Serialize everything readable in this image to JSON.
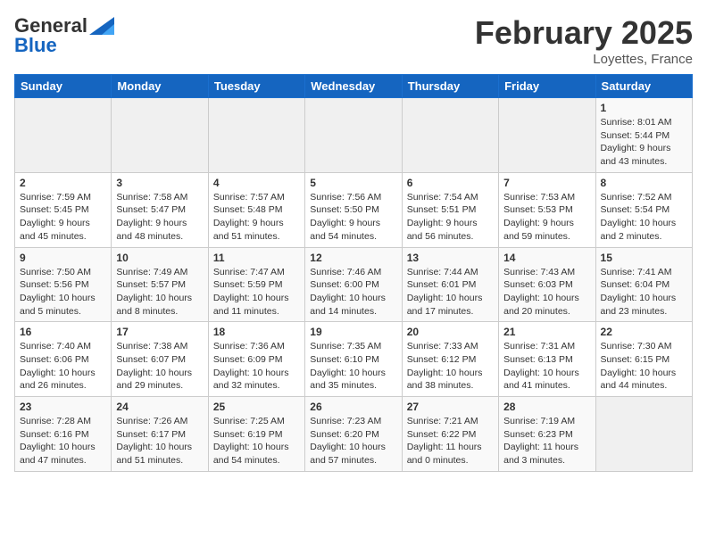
{
  "header": {
    "logo_general": "General",
    "logo_blue": "Blue",
    "month_title": "February 2025",
    "location": "Loyettes, France"
  },
  "calendar": {
    "days_of_week": [
      "Sunday",
      "Monday",
      "Tuesday",
      "Wednesday",
      "Thursday",
      "Friday",
      "Saturday"
    ],
    "weeks": [
      [
        {
          "day": "",
          "info": ""
        },
        {
          "day": "",
          "info": ""
        },
        {
          "day": "",
          "info": ""
        },
        {
          "day": "",
          "info": ""
        },
        {
          "day": "",
          "info": ""
        },
        {
          "day": "",
          "info": ""
        },
        {
          "day": "1",
          "info": "Sunrise: 8:01 AM\nSunset: 5:44 PM\nDaylight: 9 hours and 43 minutes."
        }
      ],
      [
        {
          "day": "2",
          "info": "Sunrise: 7:59 AM\nSunset: 5:45 PM\nDaylight: 9 hours and 45 minutes."
        },
        {
          "day": "3",
          "info": "Sunrise: 7:58 AM\nSunset: 5:47 PM\nDaylight: 9 hours and 48 minutes."
        },
        {
          "day": "4",
          "info": "Sunrise: 7:57 AM\nSunset: 5:48 PM\nDaylight: 9 hours and 51 minutes."
        },
        {
          "day": "5",
          "info": "Sunrise: 7:56 AM\nSunset: 5:50 PM\nDaylight: 9 hours and 54 minutes."
        },
        {
          "day": "6",
          "info": "Sunrise: 7:54 AM\nSunset: 5:51 PM\nDaylight: 9 hours and 56 minutes."
        },
        {
          "day": "7",
          "info": "Sunrise: 7:53 AM\nSunset: 5:53 PM\nDaylight: 9 hours and 59 minutes."
        },
        {
          "day": "8",
          "info": "Sunrise: 7:52 AM\nSunset: 5:54 PM\nDaylight: 10 hours and 2 minutes."
        }
      ],
      [
        {
          "day": "9",
          "info": "Sunrise: 7:50 AM\nSunset: 5:56 PM\nDaylight: 10 hours and 5 minutes."
        },
        {
          "day": "10",
          "info": "Sunrise: 7:49 AM\nSunset: 5:57 PM\nDaylight: 10 hours and 8 minutes."
        },
        {
          "day": "11",
          "info": "Sunrise: 7:47 AM\nSunset: 5:59 PM\nDaylight: 10 hours and 11 minutes."
        },
        {
          "day": "12",
          "info": "Sunrise: 7:46 AM\nSunset: 6:00 PM\nDaylight: 10 hours and 14 minutes."
        },
        {
          "day": "13",
          "info": "Sunrise: 7:44 AM\nSunset: 6:01 PM\nDaylight: 10 hours and 17 minutes."
        },
        {
          "day": "14",
          "info": "Sunrise: 7:43 AM\nSunset: 6:03 PM\nDaylight: 10 hours and 20 minutes."
        },
        {
          "day": "15",
          "info": "Sunrise: 7:41 AM\nSunset: 6:04 PM\nDaylight: 10 hours and 23 minutes."
        }
      ],
      [
        {
          "day": "16",
          "info": "Sunrise: 7:40 AM\nSunset: 6:06 PM\nDaylight: 10 hours and 26 minutes."
        },
        {
          "day": "17",
          "info": "Sunrise: 7:38 AM\nSunset: 6:07 PM\nDaylight: 10 hours and 29 minutes."
        },
        {
          "day": "18",
          "info": "Sunrise: 7:36 AM\nSunset: 6:09 PM\nDaylight: 10 hours and 32 minutes."
        },
        {
          "day": "19",
          "info": "Sunrise: 7:35 AM\nSunset: 6:10 PM\nDaylight: 10 hours and 35 minutes."
        },
        {
          "day": "20",
          "info": "Sunrise: 7:33 AM\nSunset: 6:12 PM\nDaylight: 10 hours and 38 minutes."
        },
        {
          "day": "21",
          "info": "Sunrise: 7:31 AM\nSunset: 6:13 PM\nDaylight: 10 hours and 41 minutes."
        },
        {
          "day": "22",
          "info": "Sunrise: 7:30 AM\nSunset: 6:15 PM\nDaylight: 10 hours and 44 minutes."
        }
      ],
      [
        {
          "day": "23",
          "info": "Sunrise: 7:28 AM\nSunset: 6:16 PM\nDaylight: 10 hours and 47 minutes."
        },
        {
          "day": "24",
          "info": "Sunrise: 7:26 AM\nSunset: 6:17 PM\nDaylight: 10 hours and 51 minutes."
        },
        {
          "day": "25",
          "info": "Sunrise: 7:25 AM\nSunset: 6:19 PM\nDaylight: 10 hours and 54 minutes."
        },
        {
          "day": "26",
          "info": "Sunrise: 7:23 AM\nSunset: 6:20 PM\nDaylight: 10 hours and 57 minutes."
        },
        {
          "day": "27",
          "info": "Sunrise: 7:21 AM\nSunset: 6:22 PM\nDaylight: 11 hours and 0 minutes."
        },
        {
          "day": "28",
          "info": "Sunrise: 7:19 AM\nSunset: 6:23 PM\nDaylight: 11 hours and 3 minutes."
        },
        {
          "day": "",
          "info": ""
        }
      ]
    ]
  }
}
